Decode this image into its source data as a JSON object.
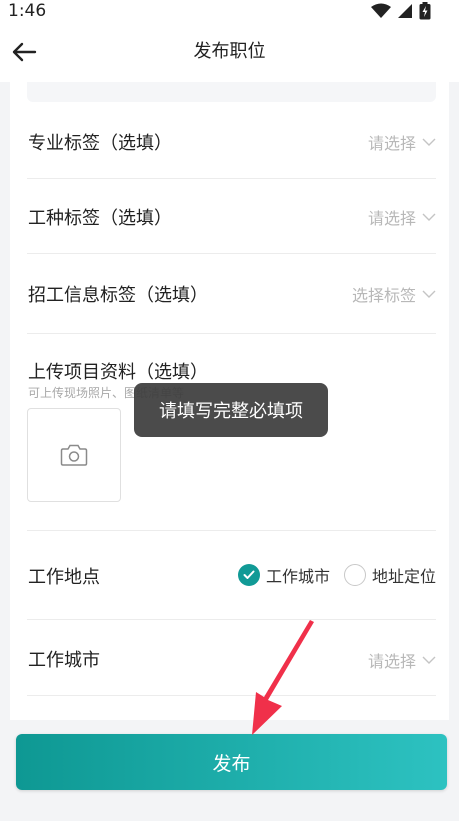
{
  "status_bar": {
    "time": "1:46"
  },
  "header": {
    "title": "发布职位"
  },
  "form": {
    "major_tag": {
      "label": "专业标签（选填）",
      "placeholder": "请选择"
    },
    "trade_tag": {
      "label": "工种标签（选填）",
      "placeholder": "请选择"
    },
    "recruit_info_tag": {
      "label": "招工信息标签（选填）",
      "placeholder": "选择标签"
    },
    "upload": {
      "title": "上传项目资料（选填）",
      "hint": "可上传现场照片、图纸清单等"
    },
    "work_location": {
      "label": "工作地点",
      "options": [
        {
          "label": "工作城市",
          "selected": true
        },
        {
          "label": "地址定位",
          "selected": false
        }
      ]
    },
    "work_city": {
      "label": "工作城市",
      "placeholder": "请选择"
    }
  },
  "toast": {
    "text": "请填写完整必填项"
  },
  "footer": {
    "publish_label": "发布"
  },
  "colors": {
    "accent": "#119a96",
    "gradient_end": "#2dc2c1",
    "annotation_arrow": "#f0304a"
  }
}
